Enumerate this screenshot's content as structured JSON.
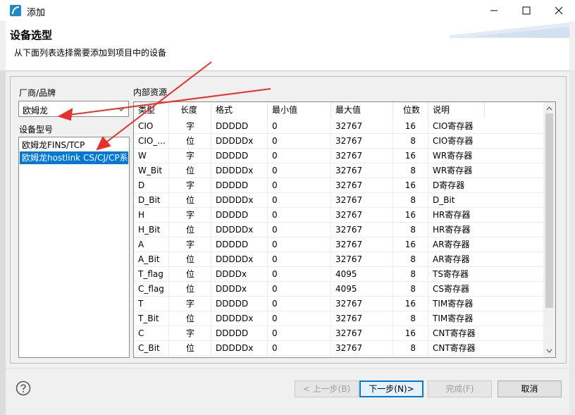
{
  "window": {
    "title": "添加"
  },
  "header": {
    "title": "设备选型",
    "subtitle": "从下面列表选择需要添加到项目中的设备"
  },
  "vendor": {
    "label": "厂商/品牌",
    "selected": "欧姆龙"
  },
  "model": {
    "label": "设备型号",
    "items": [
      {
        "label": "欧姆龙FINS/TCP",
        "selected": false
      },
      {
        "label": "欧姆龙hostlink CS/CJ/CP系",
        "selected": true
      }
    ]
  },
  "resources": {
    "label": "内部资源",
    "columns": [
      "类型",
      "长度",
      "格式",
      "最小值",
      "最大值",
      "位数",
      "说明"
    ],
    "rows": [
      [
        "CIO",
        "字",
        "DDDDD",
        "0",
        "32767",
        "16",
        "CIO寄存器"
      ],
      [
        "CIO_...",
        "位",
        "DDDDDx",
        "0",
        "32767",
        "8",
        "CIO寄存器"
      ],
      [
        "W",
        "字",
        "DDDDD",
        "0",
        "32767",
        "16",
        "WR寄存器"
      ],
      [
        "W_Bit",
        "位",
        "DDDDDx",
        "0",
        "32767",
        "8",
        "WR寄存器"
      ],
      [
        "D",
        "字",
        "DDDDD",
        "0",
        "32767",
        "16",
        "D寄存器"
      ],
      [
        "D_Bit",
        "位",
        "DDDDDx",
        "0",
        "32767",
        "8",
        "D_Bit"
      ],
      [
        "H",
        "字",
        "DDDDD",
        "0",
        "32767",
        "16",
        "HR寄存器"
      ],
      [
        "H_Bit",
        "位",
        "DDDDDx",
        "0",
        "32767",
        "8",
        "HR寄存器"
      ],
      [
        "A",
        "字",
        "DDDDD",
        "0",
        "32767",
        "16",
        "AR寄存器"
      ],
      [
        "A_Bit",
        "位",
        "DDDDDx",
        "0",
        "32767",
        "8",
        "AR寄存器"
      ],
      [
        "T_flag",
        "位",
        "DDDDx",
        "0",
        "4095",
        "8",
        "TS寄存器"
      ],
      [
        "C_flag",
        "位",
        "DDDDx",
        "0",
        "4095",
        "8",
        "CS寄存器"
      ],
      [
        "T",
        "字",
        "DDDDD",
        "0",
        "32767",
        "16",
        "TIM寄存器"
      ],
      [
        "T_Bit",
        "位",
        "DDDDDx",
        "0",
        "32767",
        "8",
        "TIM寄存器"
      ],
      [
        "C",
        "字",
        "DDDDD",
        "0",
        "32767",
        "16",
        "CNT寄存器"
      ],
      [
        "C_Bit",
        "位",
        "DDDDDx",
        "0",
        "32767",
        "8",
        "CNT寄存器"
      ]
    ]
  },
  "buttons": {
    "back": "< 上一步(B)",
    "next": "下一步(N)>",
    "finish": "完成(F)",
    "cancel": "取消"
  },
  "colors": {
    "selection": "#0078d7",
    "annotation_arrow": "#e8302a"
  },
  "icons": {
    "app": "app-logo-icon",
    "help": "help-icon",
    "dropdown": "chevron-down-icon"
  }
}
